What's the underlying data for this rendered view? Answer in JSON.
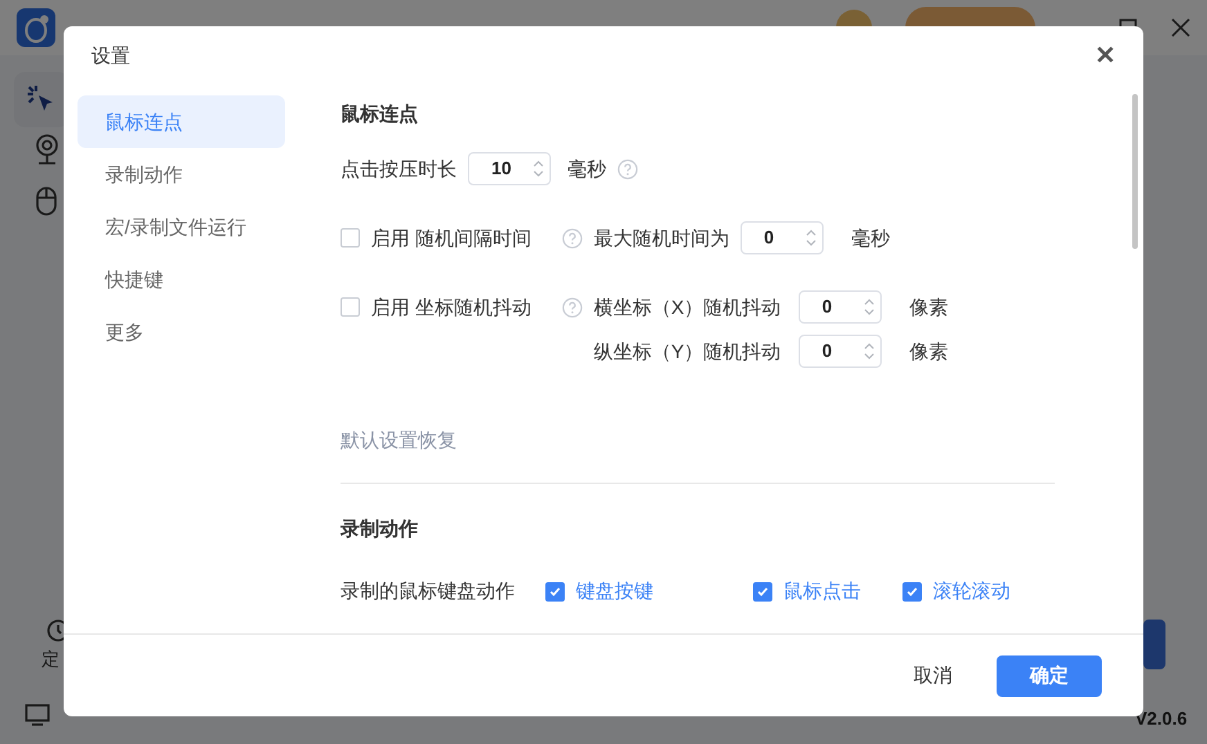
{
  "app": {
    "side_label": "定",
    "version": "V2.0.6"
  },
  "dialog": {
    "title": "设置",
    "close": "✕",
    "nav": [
      {
        "label": "鼠标连点",
        "selected": true
      },
      {
        "label": "录制动作",
        "selected": false
      },
      {
        "label": "宏/录制文件运行",
        "selected": false
      },
      {
        "label": "快捷键",
        "selected": false
      },
      {
        "label": "更多",
        "selected": false
      }
    ],
    "click_section": {
      "heading": "鼠标连点",
      "press": {
        "label": "点击按压时长",
        "value": "10",
        "unit": "毫秒"
      },
      "random_interval": {
        "label": "启用 随机间隔时间",
        "checked": false,
        "max_label": "最大随机时间为",
        "value": "0",
        "unit": "毫秒"
      },
      "jitter": {
        "label": "启用 坐标随机抖动",
        "checked": false,
        "rows": [
          {
            "label": "横坐标（X）随机抖动",
            "value": "0",
            "unit": "像素"
          },
          {
            "label": "纵坐标（Y）随机抖动",
            "value": "0",
            "unit": "像素"
          }
        ]
      },
      "reset": "默认设置恢复"
    },
    "record_section": {
      "heading": "录制动作",
      "label": "录制的鼠标键盘动作",
      "options": [
        {
          "label": "键盘按键",
          "checked": true
        },
        {
          "label": "鼠标点击",
          "checked": true
        },
        {
          "label": "滚轮滚动",
          "checked": true
        }
      ]
    },
    "buttons": {
      "cancel": "取消",
      "ok": "确定"
    }
  }
}
